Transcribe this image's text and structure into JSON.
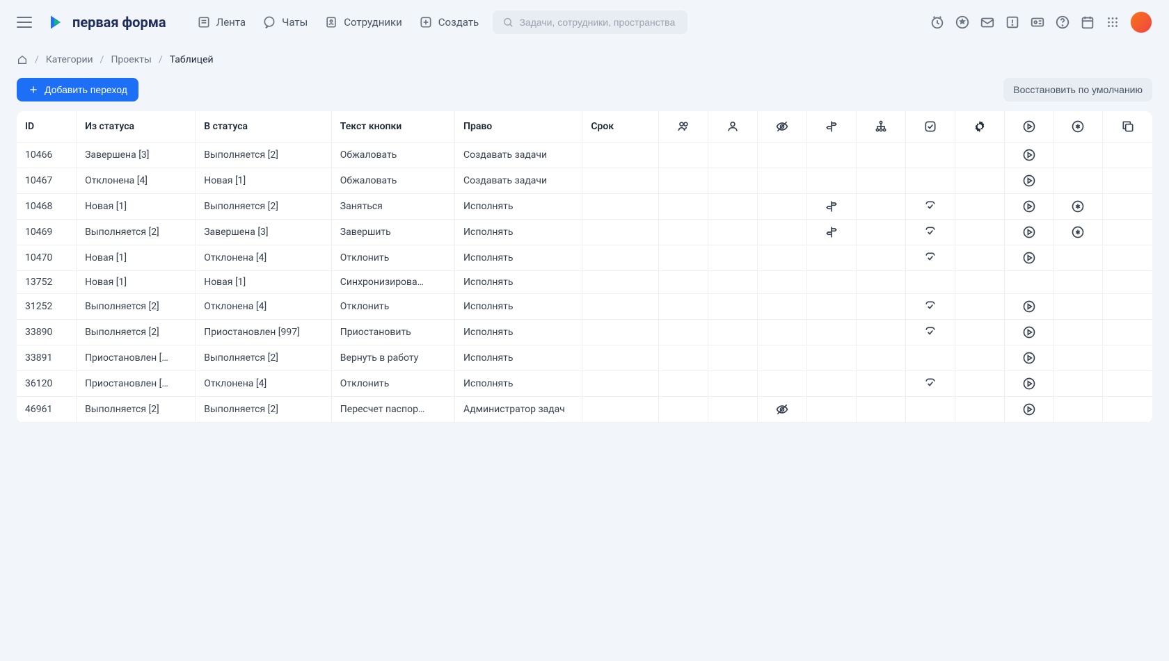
{
  "logo_text": "первая форма",
  "nav": {
    "feed": "Лента",
    "chats": "Чаты",
    "staff": "Сотрудники",
    "create": "Создать"
  },
  "search": {
    "placeholder": "Задачи, сотрудники, пространства"
  },
  "breadcrumbs": {
    "home": "",
    "cat": "Категории",
    "proj": "Проекты",
    "table": "Таблицей"
  },
  "buttons": {
    "add": "Добавить переход",
    "reset": "Восстановить по умолчанию"
  },
  "headers": {
    "id": "ID",
    "from": "Из статуса",
    "to": "В статуса",
    "btn": "Текст кнопки",
    "perm": "Право",
    "srok": "Срок"
  },
  "rows": [
    {
      "id": "10466",
      "from": "Завершена [3]",
      "to": "Выполняется [2]",
      "btn": "Обжаловать",
      "perm": "Создавать задачи",
      "sign": false,
      "hidden": false,
      "check": false,
      "play": true,
      "star": false
    },
    {
      "id": "10467",
      "from": "Отклонена [4]",
      "to": "Новая [1]",
      "btn": "Обжаловать",
      "perm": "Создавать задачи",
      "sign": false,
      "hidden": false,
      "check": false,
      "play": true,
      "star": false
    },
    {
      "id": "10468",
      "from": "Новая [1]",
      "to": "Выполняется [2]",
      "btn": "Заняться",
      "perm": "Исполнять",
      "sign": true,
      "hidden": false,
      "check": true,
      "play": true,
      "star": true
    },
    {
      "id": "10469",
      "from": "Выполняется [2]",
      "to": "Завершена [3]",
      "btn": "Завершить",
      "perm": "Исполнять",
      "sign": true,
      "hidden": false,
      "check": true,
      "play": true,
      "star": true
    },
    {
      "id": "10470",
      "from": "Новая [1]",
      "to": "Отклонена [4]",
      "btn": "Отклонить",
      "perm": "Исполнять",
      "sign": false,
      "hidden": false,
      "check": true,
      "play": true,
      "star": false
    },
    {
      "id": "13752",
      "from": "Новая [1]",
      "to": "Новая [1]",
      "btn": "Синхронизирова…",
      "perm": "Исполнять",
      "sign": false,
      "hidden": false,
      "check": false,
      "play": false,
      "star": false
    },
    {
      "id": "31252",
      "from": "Выполняется [2]",
      "to": "Отклонена [4]",
      "btn": "Отклонить",
      "perm": "Исполнять",
      "sign": false,
      "hidden": false,
      "check": true,
      "play": true,
      "star": false
    },
    {
      "id": "33890",
      "from": "Выполняется [2]",
      "to": "Приостановлен [997]",
      "btn": "Приостановить",
      "perm": "Исполнять",
      "sign": false,
      "hidden": false,
      "check": true,
      "play": true,
      "star": false
    },
    {
      "id": "33891",
      "from": "Приостановлен […",
      "to": "Выполняется [2]",
      "btn": "Вернуть в работу",
      "perm": "Исполнять",
      "sign": false,
      "hidden": false,
      "check": false,
      "play": true,
      "star": false
    },
    {
      "id": "36120",
      "from": "Приостановлен […",
      "to": "Отклонена [4]",
      "btn": "Отклонить",
      "perm": "Исполнять",
      "sign": false,
      "hidden": false,
      "check": true,
      "play": true,
      "star": false
    },
    {
      "id": "46961",
      "from": "Выполняется [2]",
      "to": "Выполняется [2]",
      "btn": "Пересчет паспор…",
      "perm": "Администратор задач",
      "sign": false,
      "hidden": true,
      "check": false,
      "play": true,
      "star": false
    }
  ]
}
